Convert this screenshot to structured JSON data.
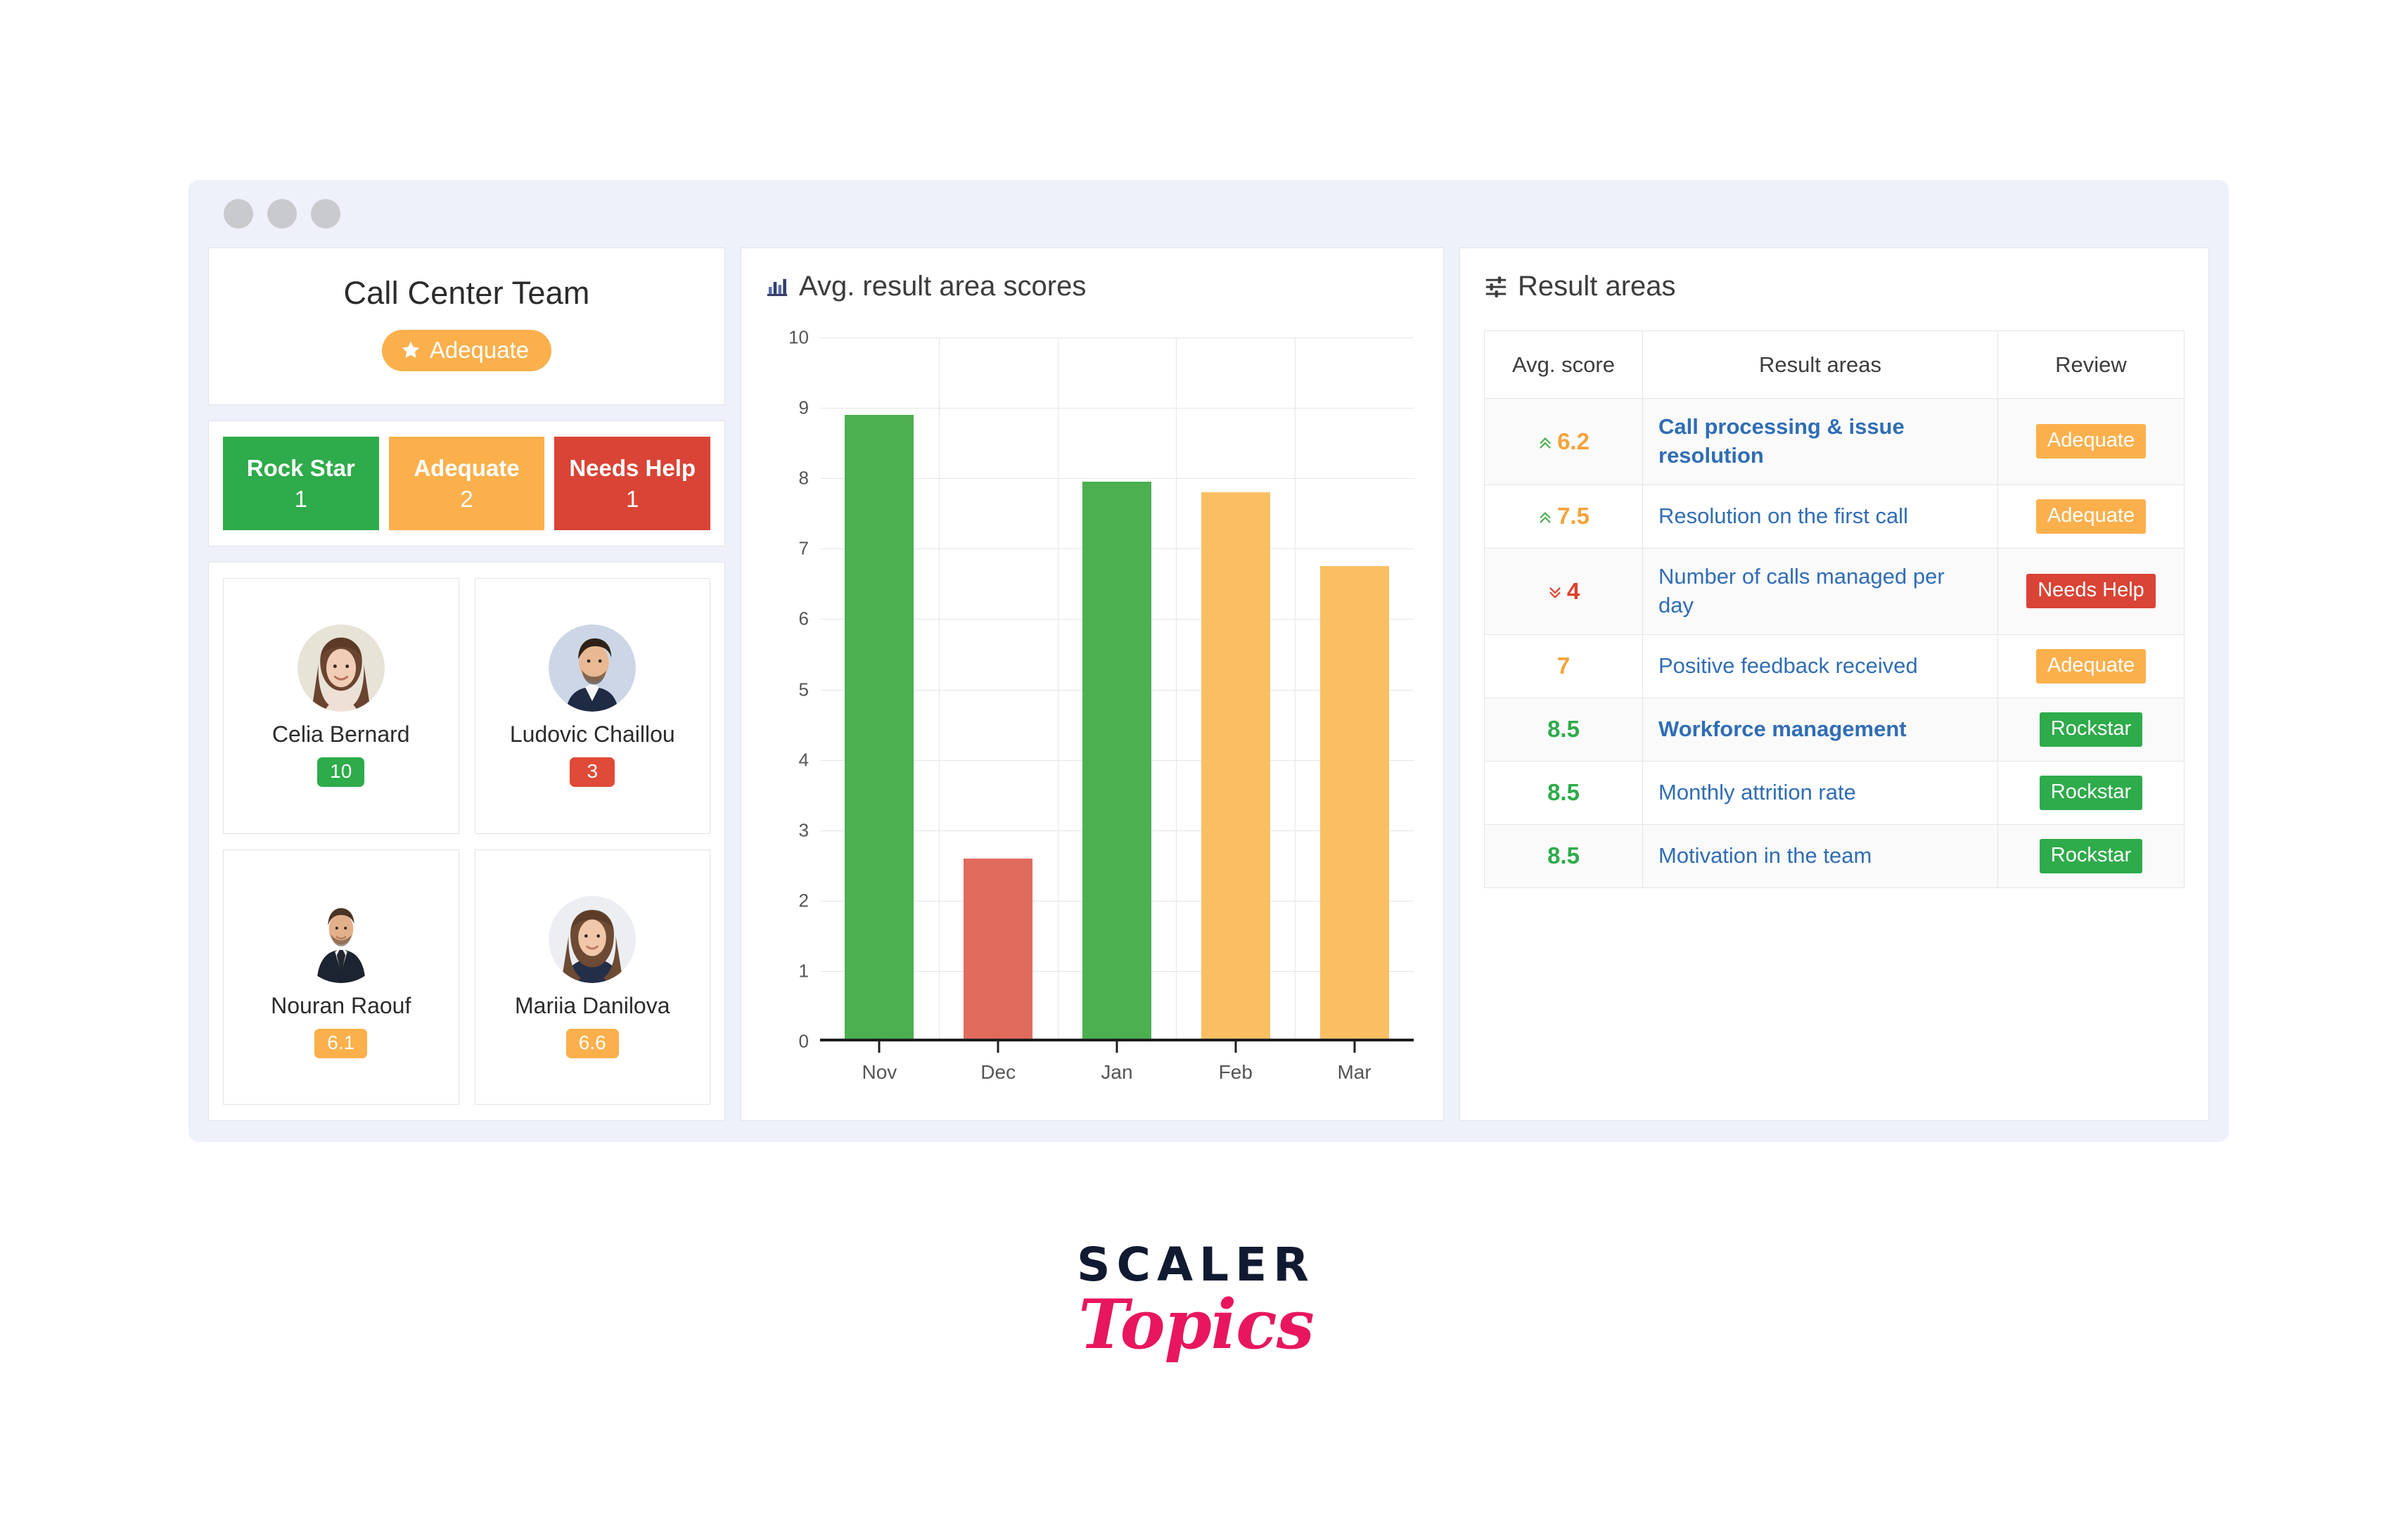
{
  "window": {
    "dots": [
      "dot-1",
      "dot-2",
      "dot-3"
    ]
  },
  "team_panel": {
    "title": "Call Center Team",
    "rating_pill": {
      "label": "Adequate",
      "icon": "star-icon",
      "color": "#fbb04c"
    },
    "stats": [
      {
        "label": "Rock Star",
        "count": "1",
        "color": "#2eab4a"
      },
      {
        "label": "Adequate",
        "count": "2",
        "color": "#fbb04c"
      },
      {
        "label": "Needs Help",
        "count": "1",
        "color": "#d94436"
      }
    ],
    "members": [
      {
        "name": "Celia Bernard",
        "score": "10",
        "color": "#2eab4a",
        "avatar": "avatar-celia-bernard"
      },
      {
        "name": "Ludovic Chaillou",
        "score": "3",
        "color": "#e04a38",
        "avatar": "avatar-ludovic-chaillou"
      },
      {
        "name": "Nouran Raouf",
        "score": "6.1",
        "color": "#fbb04c",
        "avatar": "avatar-nouran-raouf"
      },
      {
        "name": "Mariia Danilova",
        "score": "6.6",
        "color": "#fbb04c",
        "avatar": "avatar-mariia-danilova"
      }
    ]
  },
  "chart_panel": {
    "title": "Avg. result area scores",
    "icon": "bar-chart-icon"
  },
  "chart_data": {
    "type": "bar",
    "title": "Avg. result area scores",
    "xlabel": "",
    "ylabel": "",
    "ylim": [
      0,
      10
    ],
    "yticks": [
      "0",
      "1",
      "2",
      "3",
      "4",
      "5",
      "6",
      "7",
      "8",
      "9",
      "10"
    ],
    "grid": true,
    "legend": false,
    "categories": [
      "Nov",
      "Dec",
      "Jan",
      "Feb",
      "Mar"
    ],
    "values": [
      8.9,
      2.6,
      7.95,
      7.8,
      6.75
    ],
    "colors": [
      "#4caf50",
      "#e06a5c",
      "#4caf50",
      "#fbbf63",
      "#fbbf63"
    ]
  },
  "result_panel": {
    "title": "Result areas",
    "icon": "sliders-icon",
    "columns": [
      "Avg. score",
      "Result areas",
      "Review"
    ],
    "rows": [
      {
        "score": "6.2",
        "trend": "up",
        "score_color": "#f4a33a",
        "area": "Call processing & issue resolution",
        "bold": true,
        "review": "Adequate",
        "review_color": "#fbb04c",
        "striped": true
      },
      {
        "score": "7.5",
        "trend": "up",
        "score_color": "#f4a33a",
        "area": "Resolution on the first call",
        "bold": false,
        "review": "Adequate",
        "review_color": "#fbb04c",
        "striped": false
      },
      {
        "score": "4",
        "trend": "down",
        "score_color": "#e0402c",
        "area": "Number of calls managed per day",
        "bold": false,
        "review": "Needs Help",
        "review_color": "#d94436",
        "striped": true
      },
      {
        "score": "7",
        "trend": "none",
        "score_color": "#f4a33a",
        "area": "Positive feedback received",
        "bold": false,
        "review": "Adequate",
        "review_color": "#fbb04c",
        "striped": false
      },
      {
        "score": "8.5",
        "trend": "none",
        "score_color": "#2eab4a",
        "area": "Workforce management",
        "bold": true,
        "review": "Rockstar",
        "review_color": "#2eab4a",
        "striped": true
      },
      {
        "score": "8.5",
        "trend": "none",
        "score_color": "#2eab4a",
        "area": "Monthly attrition rate",
        "bold": false,
        "review": "Rockstar",
        "review_color": "#2eab4a",
        "striped": false
      },
      {
        "score": "8.5",
        "trend": "none",
        "score_color": "#2eab4a",
        "area": "Motivation in the team",
        "bold": false,
        "review": "Rockstar",
        "review_color": "#2eab4a",
        "striped": true
      }
    ]
  },
  "logo": {
    "primary": "SCALER",
    "secondary": "Topics",
    "primary_color": "#101a31",
    "secondary_color": "#e8165f"
  }
}
